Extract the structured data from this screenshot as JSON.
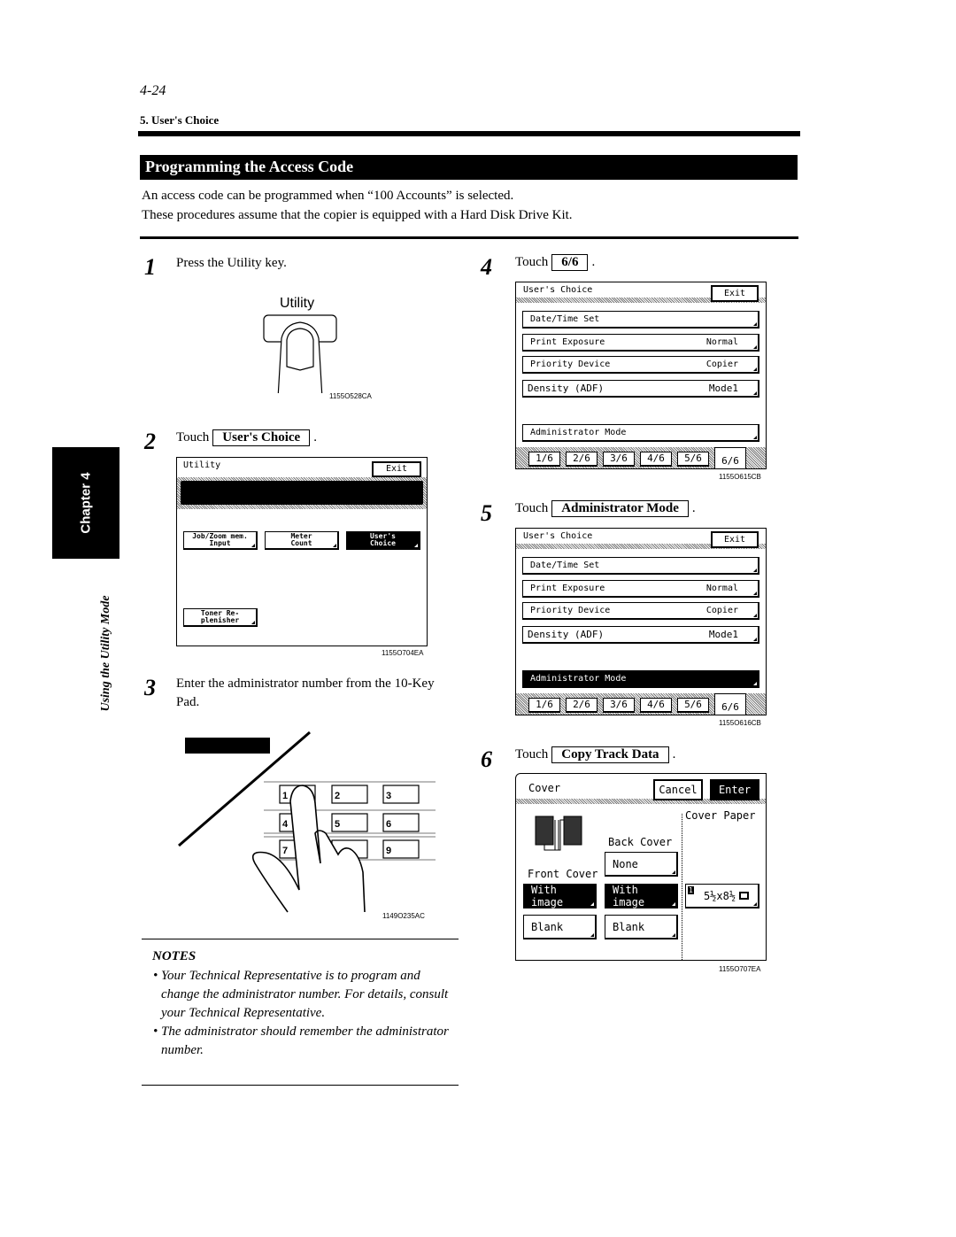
{
  "header": {
    "page_number": "4-24",
    "section": "5. User's Choice",
    "title": "Programming the Access Code",
    "intro": [
      "An access code can be programmed when “100 Accounts” is selected.",
      "These procedures assume that the copier is equipped with a Hard Disk Drive Kit."
    ]
  },
  "sidebar": {
    "chapter": "Chapter 4",
    "chapter_title": "Using the Utility Mode"
  },
  "steps": [
    {
      "number": "1",
      "text": "Press the Utility key.",
      "figure": {
        "key_label": "Utility",
        "caption": "1155O528CA"
      }
    },
    {
      "number": "2",
      "prefix": "Touch",
      "button": "User's Choice",
      "suffix": ".",
      "figure": {
        "screen_title": "Utility",
        "exit_label": "Exit",
        "buttons": [
          {
            "label": "Job/Zoom mem. Input",
            "selected": false
          },
          {
            "label": "Meter Count",
            "selected": false
          },
          {
            "label": "User's Choice",
            "selected": true
          },
          {
            "label": "Toner Re- plenisher",
            "selected": false
          }
        ],
        "caption": "1155O704EA"
      }
    },
    {
      "number": "3",
      "text": "Enter the administrator number from the 10-Key Pad.",
      "figure": {
        "keys": [
          "1",
          "2",
          "3",
          "4",
          "5",
          "6",
          "7",
          "8",
          "9"
        ],
        "caption": "1149O235AC"
      }
    },
    {
      "number": "4",
      "prefix": "Touch",
      "button": "6/6",
      "suffix": ".",
      "figure": {
        "screen_title": "User's Choice",
        "exit_label": "Exit",
        "rows": [
          {
            "label": "Date/Time Set",
            "value": ""
          },
          {
            "label": "Print Exposure",
            "value": "Normal"
          },
          {
            "label": "Priority Device",
            "value": "Copier"
          },
          {
            "label": "Density (ADF)",
            "value": "Mode1"
          }
        ],
        "admin_label": "Administrator Mode",
        "admin_selected": false,
        "tabs": [
          "1/6",
          "2/6",
          "3/6",
          "4/6",
          "5/6",
          "6/6"
        ],
        "active_tab": "6/6",
        "caption": "1155O615CB"
      }
    },
    {
      "number": "5",
      "prefix": "Touch",
      "button": "Administrator Mode",
      "suffix": ".",
      "figure": {
        "screen_title": "User's Choice",
        "exit_label": "Exit",
        "rows": [
          {
            "label": "Date/Time Set",
            "value": ""
          },
          {
            "label": "Print Exposure",
            "value": "Normal"
          },
          {
            "label": "Priority Device",
            "value": "Copier"
          },
          {
            "label": "Density (ADF)",
            "value": "Mode1"
          }
        ],
        "admin_label": "Administrator Mode",
        "admin_selected": true,
        "tabs": [
          "1/6",
          "2/6",
          "3/6",
          "4/6",
          "5/6",
          "6/6"
        ],
        "active_tab": "6/6",
        "caption": "1155O616CB"
      }
    },
    {
      "number": "6",
      "prefix": "Touch",
      "button": "Copy Track Data",
      "suffix": ".",
      "figure": {
        "screen_title": "Cover",
        "cancel_label": "Cancel",
        "enter_label": "Enter",
        "cover_paper_label": "Cover Paper",
        "back_cover_label": "Back Cover",
        "front_cover_label": "Front Cover",
        "back_none": "None",
        "front_with_image": "With image",
        "back_with_image": "With image",
        "front_blank": "Blank",
        "back_blank": "Blank",
        "tray_number": "1",
        "paper_size": "5½x8½",
        "caption": "1155O707EA"
      }
    }
  ],
  "notes": {
    "heading": "NOTES",
    "items": [
      "Your Technical Representative is to program and change the administrator number. For details, consult your Technical Representative.",
      "The administrator should remember the administrator number."
    ]
  }
}
